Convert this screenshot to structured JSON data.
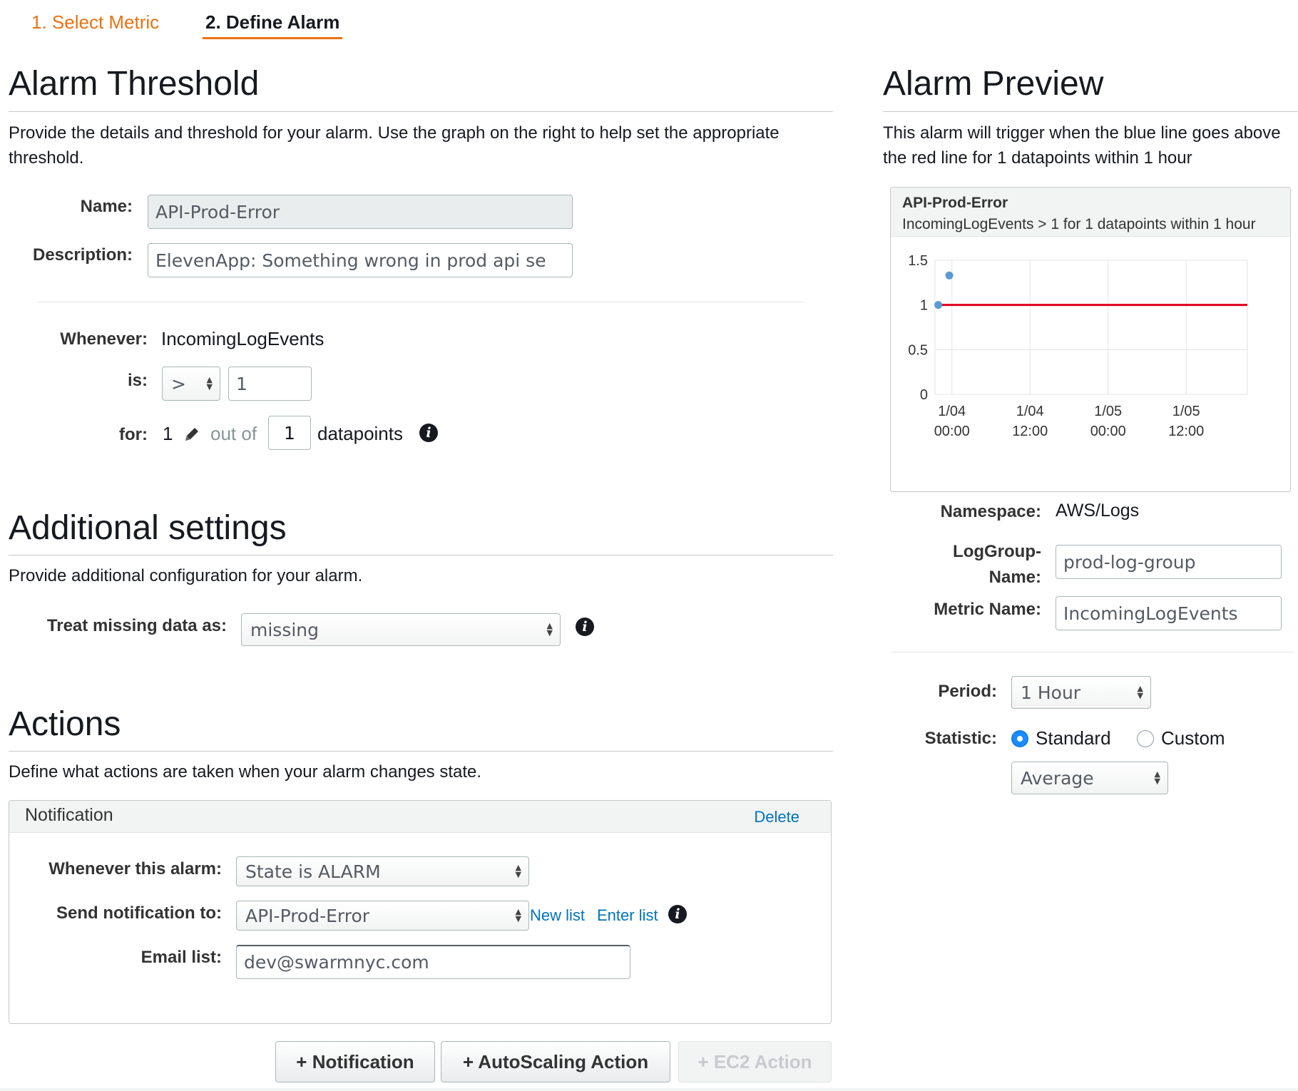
{
  "wizard": {
    "step1": "1. Select Metric",
    "step2": "2. Define Alarm"
  },
  "threshold": {
    "title": "Alarm Threshold",
    "description": "Provide the details and threshold for your alarm. Use the graph on the right to help set the appropriate threshold.",
    "name_label": "Name:",
    "name_value": "API-Prod-Error",
    "desc_label": "Description:",
    "desc_value": "ElevenApp: Something wrong in prod api se",
    "whenever_label": "Whenever:",
    "whenever_value": "IncomingLogEvents",
    "is_label": "is:",
    "operator": ">",
    "threshold_value": "1",
    "for_label": "for:",
    "for_value": "1",
    "out_of_label": "out of",
    "out_of_value": "1",
    "datapoints_label": "datapoints"
  },
  "additional": {
    "title": "Additional settings",
    "description": "Provide additional configuration for your alarm.",
    "missing_label": "Treat missing data as:",
    "missing_value": "missing"
  },
  "actions": {
    "title": "Actions",
    "description": "Define what actions are taken when your alarm changes state.",
    "notification": {
      "header": "Notification",
      "delete_label": "Delete",
      "whenever_label": "Whenever this alarm:",
      "whenever_value": "State is ALARM",
      "send_label": "Send notification to:",
      "send_value": "API-Prod-Error",
      "new_list_label": "New list",
      "enter_list_label": "Enter list",
      "email_label": "Email list:",
      "email_value": "dev@swarmnyc.com"
    },
    "buttons": {
      "notification": "+ Notification",
      "autoscaling": "+ AutoScaling Action",
      "ec2": "+ EC2 Action"
    }
  },
  "preview": {
    "title": "Alarm Preview",
    "description": "This alarm will trigger when the blue line goes above the red line for 1 datapoints within 1 hour",
    "chart_title": "API-Prod-Error",
    "chart_subtitle": "IncomingLogEvents > 1 for 1 datapoints within 1 hour",
    "namespace_label": "Namespace:",
    "namespace_value": "AWS/Logs",
    "loggroup_label_1": "LogGroup-",
    "loggroup_label_2": "Name:",
    "loggroup_value": "prod-log-group",
    "metric_label": "Metric Name:",
    "metric_value": "IncomingLogEvents",
    "period_label": "Period:",
    "period_value": "1 Hour",
    "statistic_label": "Statistic:",
    "standard_label": "Standard",
    "custom_label": "Custom",
    "statistic_value": "Average"
  },
  "colors": {
    "accent": "#ec7211",
    "link": "#0073bb",
    "threshold_line": "#e0001b",
    "datapoint": "#5b9bd5"
  },
  "chart_data": {
    "type": "line",
    "title": "API-Prod-Error",
    "subtitle": "IncomingLogEvents > 1 for 1 datapoints within 1 hour",
    "x_ticks": [
      {
        "date": "1/04",
        "time": "00:00",
        "hours": 0
      },
      {
        "date": "1/04",
        "time": "12:00",
        "hours": 12
      },
      {
        "date": "1/05",
        "time": "00:00",
        "hours": 24
      },
      {
        "date": "1/05",
        "time": "12:00",
        "hours": 36
      }
    ],
    "xlim_hours": [
      -2.6,
      45.4
    ],
    "y_ticks": [
      "1.5",
      "1",
      "0.5",
      "0"
    ],
    "ylim": [
      0,
      1.5
    ],
    "series": [
      {
        "values": [
          {
            "hours": -2.1,
            "value": 1.0
          },
          {
            "hours": -0.4,
            "value": 1.33
          }
        ]
      }
    ],
    "threshold": 1,
    "grid": true
  }
}
